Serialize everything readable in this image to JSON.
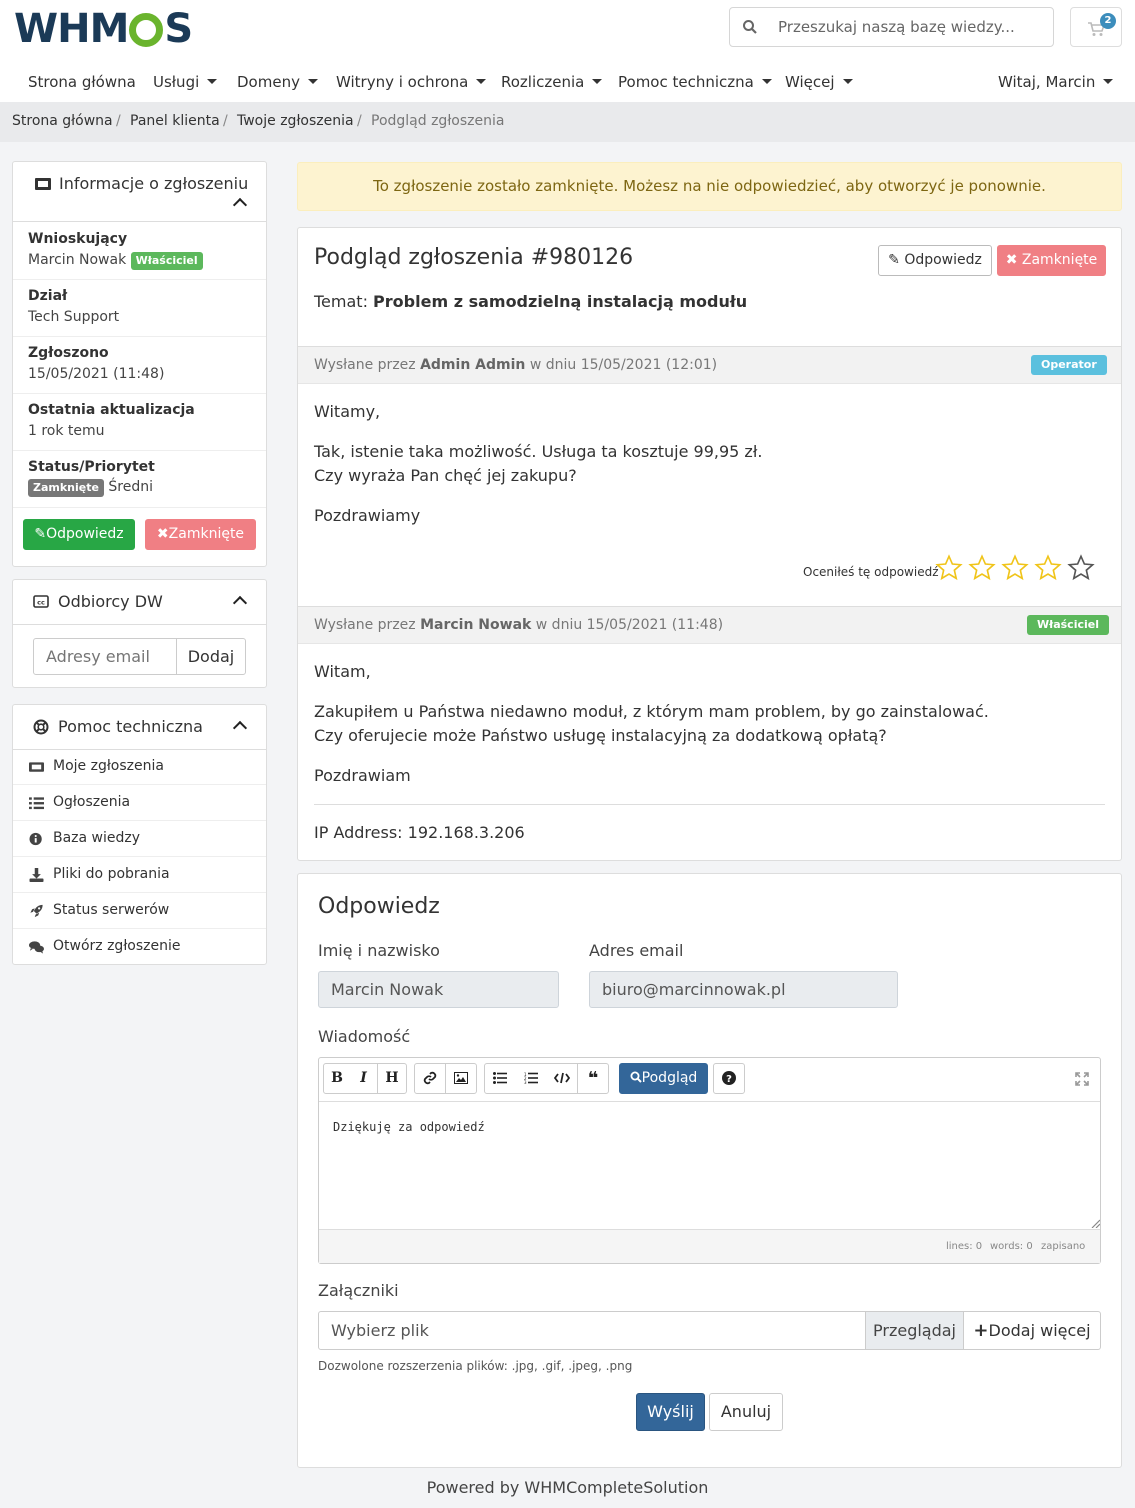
{
  "brand": {
    "logo_text_left": "WHM",
    "logo_text_right": "S"
  },
  "search": {
    "placeholder": "Przeszukaj naszą bazę wiedzy..."
  },
  "cart": {
    "count": "2"
  },
  "nav": {
    "items": [
      "Strona główna",
      "Usługi",
      "Domeny",
      "Witryny i ochrona",
      "Rozliczenia",
      "Pomoc techniczna",
      "Więcej"
    ],
    "user": "Witaj, Marcin"
  },
  "breadcrumb": [
    "Strona główna",
    "Panel klienta",
    "Twoje zgłoszenia",
    "Podgląd zgłoszenia"
  ],
  "sidebar": {
    "ticket_info": {
      "title": "Informacje o zgłoszeniu",
      "requester_label": "Wnioskujący",
      "requester": "Marcin Nowak",
      "owner_badge": "Właściciel",
      "dept_label": "Dział",
      "dept": "Tech Support",
      "submitted_label": "Zgłoszono",
      "submitted": "15/05/2021 (11:48)",
      "updated_label": "Ostatnia aktualizacja",
      "updated": "1 rok temu",
      "status_label": "Status/Priorytet",
      "status": "Zamknięte",
      "priority": "Średni",
      "reply_btn": "Odpowiedz",
      "closed_btn": "Zamknięte"
    },
    "cc": {
      "title": "Odbiorcy DW",
      "placeholder": "Adresy email",
      "add_btn": "Dodaj"
    },
    "support": {
      "title": "Pomoc techniczna",
      "items": [
        "Moje zgłoszenia",
        "Ogłoszenia",
        "Baza wiedzy",
        "Pliki do pobrania",
        "Status serwerów",
        "Otwórz zgłoszenie"
      ]
    }
  },
  "alert": "To zgłoszenie zostało zamknięte. Możesz na nie odpowiedzieć, aby otworzyć je ponownie.",
  "ticket": {
    "title": "Podgląd zgłoszenia #980126",
    "reply_btn": "Odpowiedz",
    "closed_btn": "Zamknięte",
    "subject_label": "Temat:",
    "subject": "Problem z samodzielną instalacją modułu",
    "messages": [
      {
        "prefix": "Wysłane przez",
        "author": "Admin Admin",
        "suffix": "w dniu 15/05/2021 (12:01)",
        "badge": "Operator",
        "badge_color": "#5bc0de",
        "lines": [
          "Witamy,",
          "Tak, istenie taka możliwość. Usługa ta kosztuje 99,95 zł.",
          "Czy wyraża Pan chęć jej zakupu?",
          "Pozdrawiamy"
        ],
        "rating_label": "Oceniłeś tę odpowiedź",
        "rating": 4,
        "rating_max": 5
      },
      {
        "prefix": "Wysłane przez",
        "author": "Marcin Nowak",
        "suffix": "w dniu 15/05/2021 (11:48)",
        "badge": "Właściciel",
        "badge_color": "#5cb85c",
        "lines": [
          "Witam,",
          "Zakupiłem u Państwa niedawno moduł, z którym mam problem, by go zainstalować.",
          "Czy oferujecie może Państwo usługę instalacyjną za dodatkową opłatą?",
          "Pozdrawiam"
        ],
        "ip": "IP Address: 192.168.3.206"
      }
    ]
  },
  "reply_form": {
    "title": "Odpowiedz",
    "name_label": "Imię i nazwisko",
    "name": "Marcin Nowak",
    "email_label": "Adres email",
    "email": "biuro@marcinnowak.pl",
    "message_label": "Wiadomość",
    "preview_btn": "Podgląd",
    "message": "Dziękuję za odpowiedź",
    "status_lines": "lines: 0",
    "status_words": "words: 0",
    "status_saved": "zapisano",
    "attachments_label": "Załączniki",
    "file_placeholder": "Wybierz plik",
    "browse_btn": "Przeglądaj",
    "add_more_btn": "Dodaj więcej",
    "allowed": "Dozwolone rozszerzenia plików: .jpg, .gif, .jpeg, .png",
    "send_btn": "Wyślij",
    "cancel_btn": "Anuluj"
  },
  "footer": "Powered by WHMCompleteSolution",
  "colors": {
    "brand_dark": "#1b3a57",
    "brand_green": "#6ab42d",
    "primary": "#336699",
    "success": "#28a745",
    "danger_light": "#f07f84",
    "star": "#f0c419"
  }
}
